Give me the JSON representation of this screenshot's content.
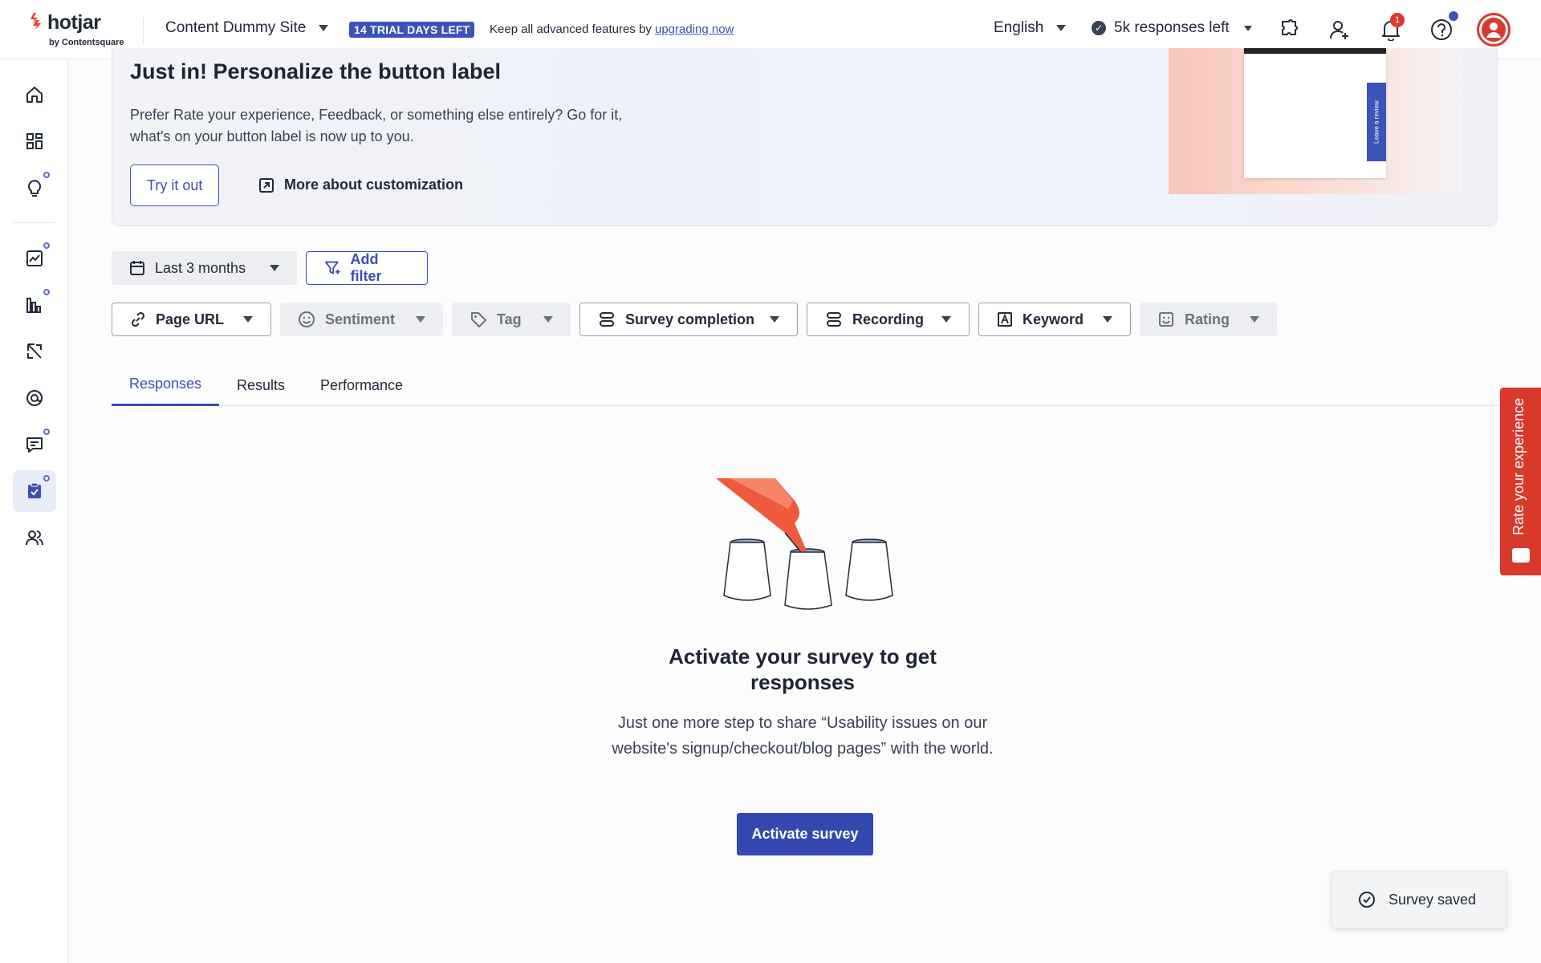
{
  "header": {
    "logo_word": "hotjar",
    "logo_sub": "by Contentsquare",
    "site_name": "Content Dummy Site",
    "trial_badge": "14 TRIAL DAYS LEFT",
    "upgrade_text": "Keep all advanced features by",
    "upgrade_link": "upgrading now",
    "language": "English",
    "responses_left": "5k responses left",
    "notification_count": "1"
  },
  "sidebar": {
    "items": [
      {
        "icon": "home-icon"
      },
      {
        "icon": "dashboard-icon"
      },
      {
        "icon": "lightbulb-icon"
      },
      {
        "icon": "trends-icon"
      },
      {
        "icon": "heatmaps-icon"
      },
      {
        "icon": "recordings-icon"
      },
      {
        "icon": "highlights-icon"
      },
      {
        "icon": "feedback-icon"
      },
      {
        "icon": "surveys-icon"
      },
      {
        "icon": "interviews-icon"
      }
    ]
  },
  "banner": {
    "title": "Just in! Personalize the button label",
    "body": "Prefer Rate your experience, Feedback, or something else entirely? Go for it, what's on your button label is now up to you.",
    "try_label": "Try it out",
    "more_label": "More about customization",
    "promo_tab_text": "Leave a review"
  },
  "filters": {
    "date_range": "Last 3 months",
    "add_filter": "Add filter",
    "chips": {
      "page_url": "Page URL",
      "sentiment": "Sentiment",
      "tag": "Tag",
      "survey_completion": "Survey completion",
      "recording": "Recording",
      "keyword": "Keyword",
      "rating": "Rating"
    }
  },
  "tabs": {
    "responses": "Responses",
    "results": "Results",
    "performance": "Performance"
  },
  "empty_state": {
    "title": "Activate your survey to get responses",
    "description": "Just one more step to share “Usability issues on our website's signup/checkout/blog pages” with the world.",
    "button": "Activate survey"
  },
  "feedback_tab": "Rate your experience",
  "toast": "Survey saved",
  "colors": {
    "brand_red": "#d9392b",
    "primary_blue": "#3548b0",
    "accent_blue": "#3c53b9"
  }
}
